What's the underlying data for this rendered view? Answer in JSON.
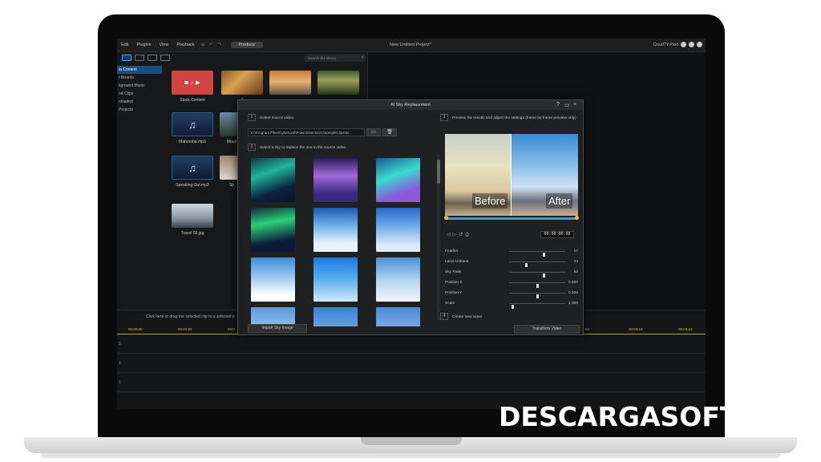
{
  "menu": {
    "items": [
      "Edit",
      "Plugins",
      "View",
      "Playback"
    ],
    "produce_label": "Produce",
    "project_title": "New Untitled Project*",
    "cloud_status": "CloudTY Prod"
  },
  "library": {
    "search_placeholder": "Search the library",
    "sidebar_items": [
      "ia Content",
      "r Boards",
      "kground Music",
      "nd Clips",
      "nloaded",
      "Projects"
    ],
    "tiles": [
      {
        "label": "Stock Content"
      },
      {
        "label": "F"
      },
      {
        "label": "Mahoroba.mp3"
      },
      {
        "label": "Moun"
      },
      {
        "label": "Speaking Out.mp3"
      },
      {
        "label": "Sp"
      },
      {
        "label": "Travel 02.jpg"
      }
    ]
  },
  "timeline": {
    "hint": "Click here or drag the selected clip to a selected tr",
    "ruler_marks": [
      "00;00;00",
      "00;01;24",
      "00;0",
      "04",
      "00;03;24",
      "00;03;12"
    ],
    "track_indices": [
      "1",
      "1",
      "1"
    ]
  },
  "dialog": {
    "title": "AI Sky Replacement",
    "step1_label": "Select source video",
    "step1_num": "1",
    "source_path": "C:\\Program Files\\CyberLink\\PowerDirector21\\SampleClips\\ris",
    "step2_label": "Select a sky to replace the one in the source video",
    "step2_num": "2",
    "step3_label": "Preview the results and adjust the settings (frame by frame preview only)",
    "step3_num": "3",
    "step4_label": "Create new video",
    "step4_num": "4",
    "import_label": "Import Sky Image",
    "transform_label": "Transform Video",
    "before_label": "Before",
    "after_label": "After",
    "timecode": "00:00:00:00",
    "params": [
      {
        "label": "Feather",
        "value": "17",
        "level": 0.62
      },
      {
        "label": "Land Ambient",
        "value": "34",
        "level": 0.3
      },
      {
        "label": "Sky Fade",
        "value": "50",
        "level": 0.62
      },
      {
        "label": "Position X",
        "value": "0.500",
        "level": 0.5
      },
      {
        "label": "Position Y",
        "value": "0.500",
        "level": 0.5
      },
      {
        "label": "Scale",
        "value": "1.000",
        "level": 0.05
      }
    ]
  },
  "watermark": "DESCARGASOFTS",
  "colors": {
    "accent": "#3aa0d8",
    "stock_red": "#d14444",
    "sidebar_active": "#1a4e7e"
  }
}
